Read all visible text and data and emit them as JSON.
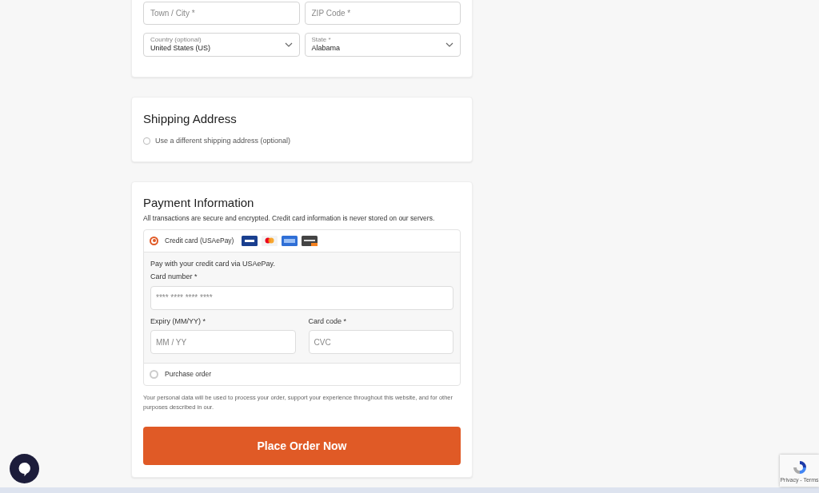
{
  "address_fields": [
    {
      "kind": "input",
      "placeholder": "Town / City *"
    },
    {
      "kind": "input",
      "placeholder": "ZIP Code *"
    },
    {
      "kind": "select",
      "label": "Country (optional)",
      "value": "United States (US)"
    },
    {
      "kind": "select",
      "label": "State *",
      "value": "Alabama"
    }
  ],
  "shipping": {
    "title": "Shipping Address",
    "checkbox": {
      "label": "Use a different shipping address (optional)",
      "checked": false
    }
  },
  "payment": {
    "title": "Payment Information",
    "subtitle": "All transactions are secure and encrypted. Credit card information is never stored on our servers.",
    "methods": [
      {
        "label": "Credit card (USAePay)",
        "selected": true,
        "description": "Pay with your credit card via USAePay.",
        "card_number": {
          "label": "Card number *",
          "placeholder": "**** **** **** ****"
        },
        "expiry": {
          "label": "Expiry (MM/YY) *",
          "placeholder": "MM / YY"
        },
        "code": {
          "label": "Card code *",
          "placeholder": "CVC"
        }
      },
      {
        "label": "Purchase order",
        "selected": false
      }
    ]
  },
  "privacy_note": "Your personal data will be used to process your order, support your experience throughout this website, and for other purposes described in our.",
  "place_order": "Place Order Now",
  "recaptcha": "Privacy - Terms"
}
